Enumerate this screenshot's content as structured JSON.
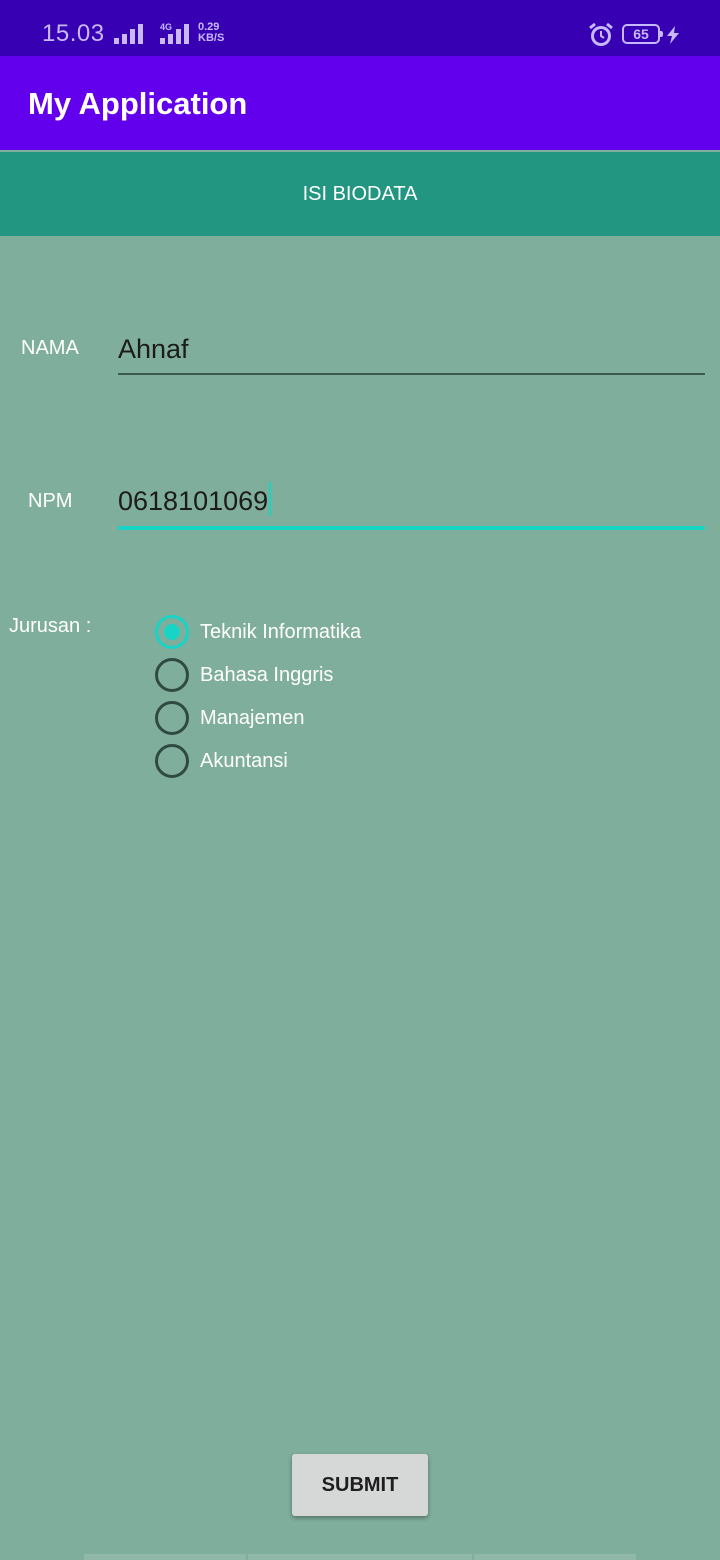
{
  "status_bar": {
    "time": "15.03",
    "network_type": "4G",
    "speed_value": "0.29",
    "speed_unit": "KB/S",
    "battery_level": "65",
    "icons": [
      "signal-icon",
      "signal-4g-icon",
      "alarm-icon",
      "battery-icon",
      "charging-bolt-icon"
    ]
  },
  "app_bar": {
    "title": "My Application"
  },
  "banner": {
    "text": "ISI BIODATA"
  },
  "form": {
    "nama": {
      "label": "NAMA",
      "value": "Ahnaf"
    },
    "npm": {
      "label": "NPM",
      "value": "0618101069"
    },
    "jurusan": {
      "label": "Jurusan :",
      "options": [
        {
          "label": "Teknik Informatika",
          "checked": true
        },
        {
          "label": "Bahasa Inggris",
          "checked": false
        },
        {
          "label": "Manajemen",
          "checked": false
        },
        {
          "label": "Akuntansi",
          "checked": false
        }
      ]
    },
    "submit_label": "SUBMIT"
  },
  "colors": {
    "status_bar": "#3700b3",
    "app_bar": "#6200ee",
    "banner": "#229680",
    "background": "#80ae9c",
    "accent": "#18d4c4"
  }
}
